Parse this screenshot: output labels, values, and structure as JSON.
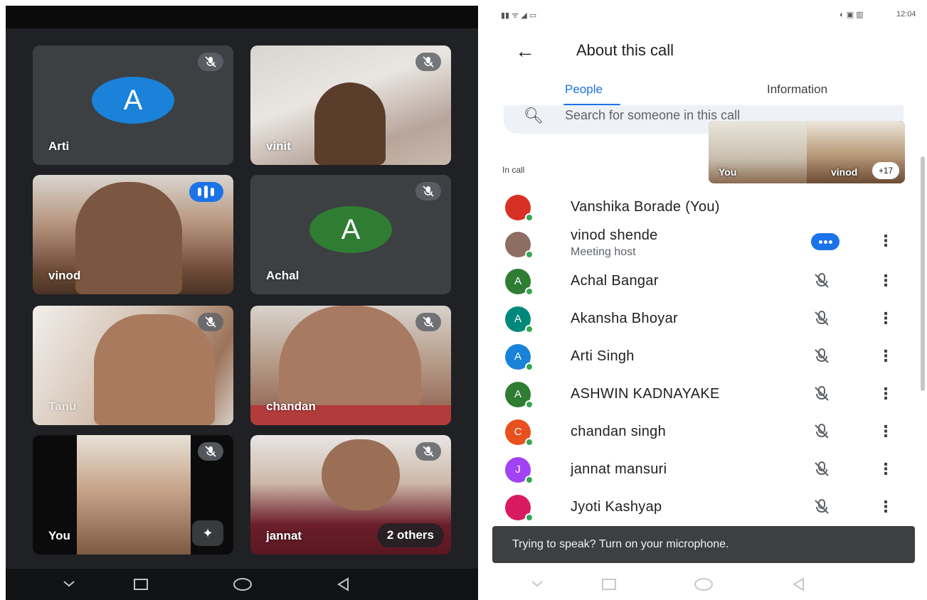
{
  "meet_grid": {
    "tiles": [
      {
        "name": "Arti",
        "type": "avatar",
        "initial": "A",
        "avatar_color": "#1a82d9",
        "mic": "muted"
      },
      {
        "name": "vinit",
        "type": "video",
        "mic": "muted"
      },
      {
        "name": "vinod",
        "type": "video",
        "mic": "speaking"
      },
      {
        "name": "Achal",
        "type": "avatar",
        "initial": "A",
        "avatar_color": "#2e7d32",
        "mic": "muted"
      },
      {
        "name": "Tanu",
        "type": "video",
        "mic": "muted"
      },
      {
        "name": "chandan",
        "type": "video",
        "mic": "muted"
      },
      {
        "name": "You",
        "type": "video",
        "mic": "muted"
      },
      {
        "name": "jannat",
        "type": "video",
        "mic": "muted"
      }
    ],
    "others_label": "2 others"
  },
  "call_info": {
    "status_time": "12:04",
    "title": "About this call",
    "tabs": [
      {
        "label": "People",
        "active": true
      },
      {
        "label": "Information",
        "active": false
      }
    ],
    "search_placeholder": "Search for someone in this call",
    "pip": {
      "self_label": "You",
      "other_label": "vinod",
      "extra_count": "+17"
    },
    "section_label": "In call",
    "participants": [
      {
        "name": "Vanshika Borade (You)",
        "subtitle": "",
        "initial": "",
        "color": "#d93025",
        "status": "none"
      },
      {
        "name": "vinod shende",
        "subtitle": "Meeting host",
        "initial": "",
        "color": "#8d6e63",
        "status": "speaking"
      },
      {
        "name": "Achal Bangar",
        "subtitle": "",
        "initial": "A",
        "color": "#2e7d32",
        "status": "muted"
      },
      {
        "name": "Akansha Bhoyar",
        "subtitle": "",
        "initial": "A",
        "color": "#00897b",
        "status": "muted"
      },
      {
        "name": "Arti Singh",
        "subtitle": "",
        "initial": "A",
        "color": "#1a82d9",
        "status": "muted"
      },
      {
        "name": "ASHWIN KADNAYAKE",
        "subtitle": "",
        "initial": "A",
        "color": "#2e7d32",
        "status": "muted"
      },
      {
        "name": "chandan singh",
        "subtitle": "",
        "initial": "C",
        "color": "#e8511d",
        "status": "muted"
      },
      {
        "name": "jannat mansuri",
        "subtitle": "",
        "initial": "J",
        "color": "#a142f4",
        "status": "muted"
      },
      {
        "name": "Jyoti Kashyap",
        "subtitle": "",
        "initial": "",
        "color": "#d81b60",
        "status": "muted"
      }
    ],
    "toast": "Trying to speak? Turn on your microphone."
  }
}
